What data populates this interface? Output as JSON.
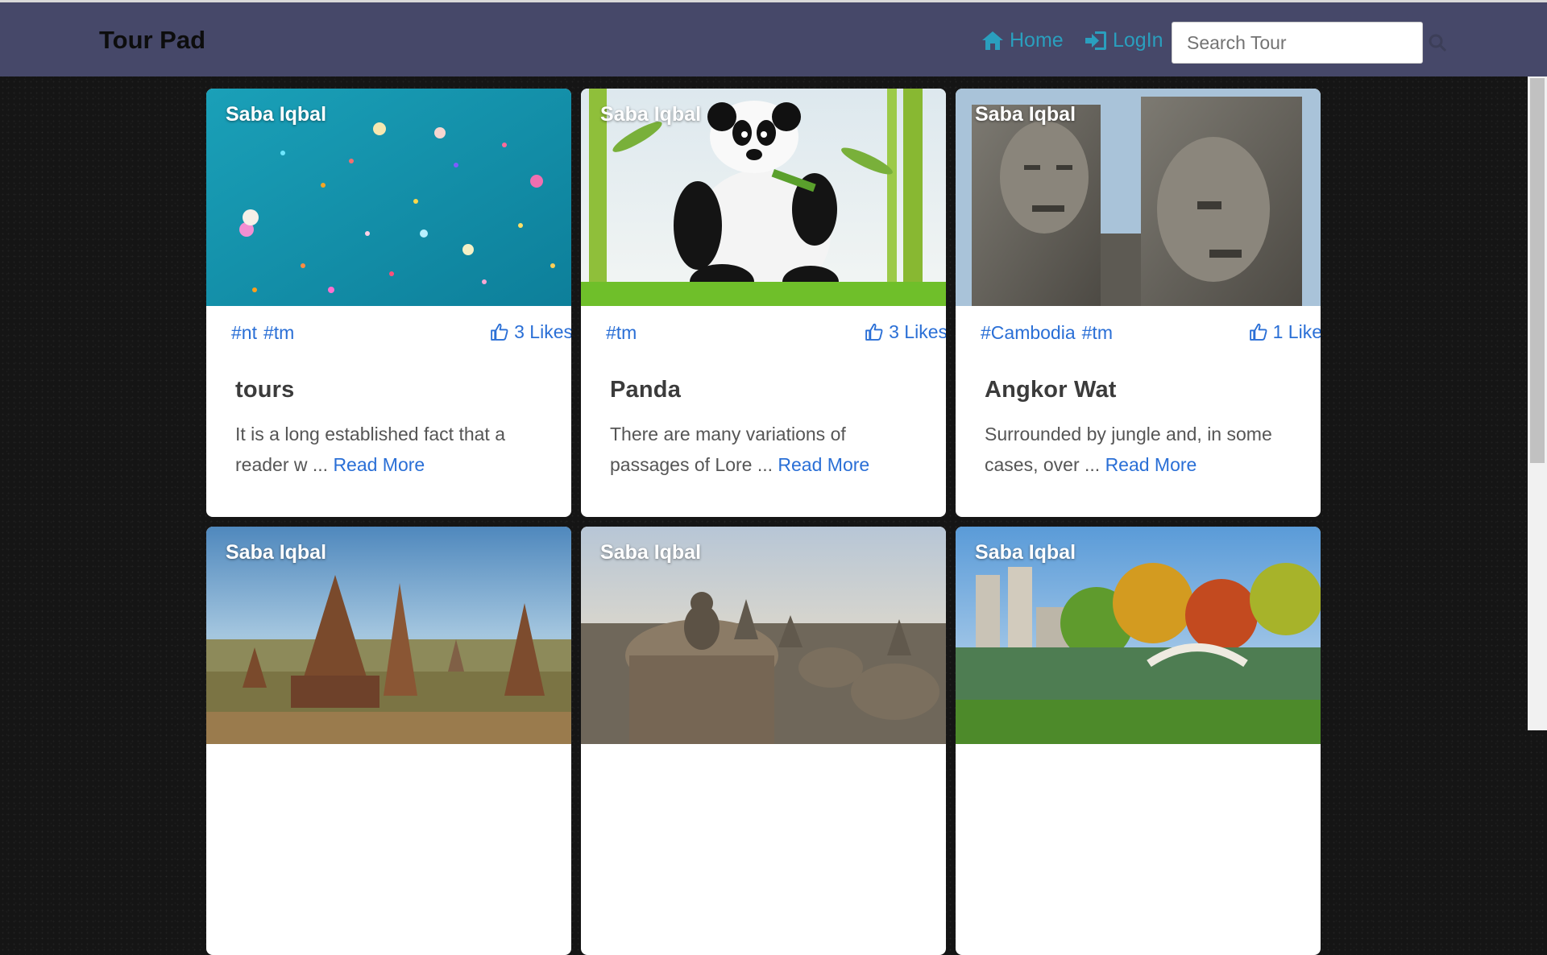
{
  "navbar": {
    "brand": "Tour Pad",
    "home_label": "Home",
    "login_label": "LogIn",
    "search_placeholder": "Search Tour"
  },
  "colors": {
    "navbar": "#464869",
    "link": "#2a9fbe",
    "accent": "#2a6fd6"
  },
  "cards": [
    {
      "author": "Saba Iqbal",
      "tags": [
        "#nt",
        "#tm"
      ],
      "likes": "3 Likes",
      "title": "tours",
      "excerpt": "It is a long established fact that a reader w ...",
      "read_more": "Read More",
      "image": "confetti-image"
    },
    {
      "author": "Saba Iqbal",
      "tags": [
        "#tm"
      ],
      "likes": "3 Likes",
      "title": "Panda",
      "excerpt": "There are many variations of passages of Lore ...",
      "read_more": "Read More",
      "image": "panda-image"
    },
    {
      "author": "Saba Iqbal",
      "tags": [
        "#Cambodia",
        "#tm"
      ],
      "likes": "1 Like",
      "title": "Angkor Wat",
      "excerpt": "Surrounded by jungle and, in some cases, over ...",
      "read_more": "Read More",
      "image": "angkor-wat-image"
    },
    {
      "author": "Saba Iqbal",
      "image": "bagan-temples-image"
    },
    {
      "author": "Saba Iqbal",
      "image": "borobudur-image"
    },
    {
      "author": "Saba Iqbal",
      "image": "central-park-image"
    }
  ]
}
